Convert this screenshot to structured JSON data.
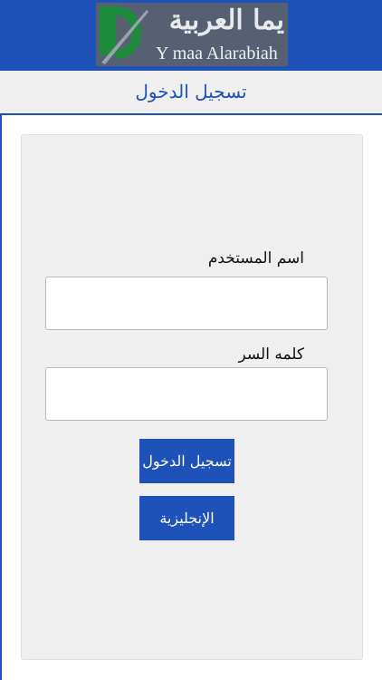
{
  "header": {
    "logo_arabic": "يما العربية",
    "logo_english": "Y maa Alarabiah",
    "logo_icon": "logo-mark-icon"
  },
  "titlebar": {
    "title": "تسجيل الدخول"
  },
  "form": {
    "username_label": "اسم المستخدم",
    "username_value": "",
    "password_label": "كلمه السر",
    "password_value": "",
    "login_button": "تسجيل الدخول",
    "language_button": "الإنجليزية"
  },
  "colors": {
    "primary": "#1f52b8",
    "panel": "#efefef",
    "logo_bg": "#566072",
    "logo_green": "#1e8a3c"
  }
}
